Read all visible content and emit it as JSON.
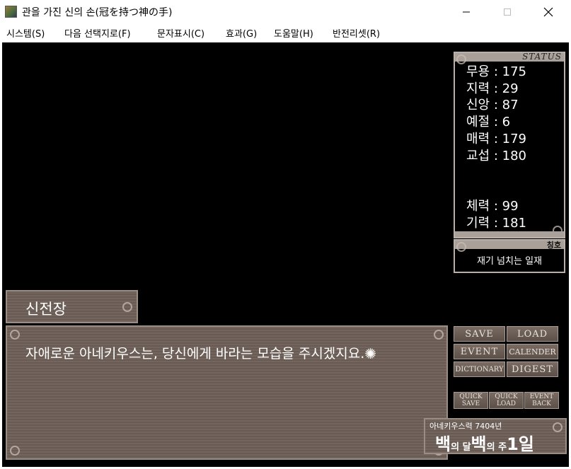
{
  "window": {
    "title": "관을 가진 신의 손(冠を持つ神の手)",
    "controls": {
      "minimize": "—",
      "maximize": "☐",
      "close": "✕"
    }
  },
  "menu": [
    {
      "label": "시스템(S)"
    },
    {
      "label": "다음 선택지로(F)"
    },
    {
      "label": "문자표시(C)"
    },
    {
      "label": "효과(G)"
    },
    {
      "label": "도움말(H)"
    },
    {
      "label": "반전리셋(R)"
    }
  ],
  "status": {
    "title": "STATUS",
    "stats": [
      {
        "label": "무용",
        "value": 175
      },
      {
        "label": "지력",
        "value": 29
      },
      {
        "label": "신앙",
        "value": 87
      },
      {
        "label": "예절",
        "value": 6
      },
      {
        "label": "매력",
        "value": 179
      },
      {
        "label": "교섭",
        "value": 180
      },
      {
        "label": "체력",
        "value": 99
      },
      {
        "label": "기력",
        "value": 181
      }
    ]
  },
  "title_panel": {
    "label": "칭호",
    "value": "재기 넘치는 일재"
  },
  "dialog": {
    "speaker": "신전장",
    "text": "자애로운 아네키우스는, 당신에게 바라는 모습을 주시겠지요."
  },
  "buttons": {
    "save": "SAVE",
    "load": "LOAD",
    "event": "EVENT",
    "calender": "CALENDER",
    "dictionary": "DICTIONARY",
    "digest": "DIGEST",
    "quick_save": [
      "QUICK",
      "SAVE"
    ],
    "quick_load": [
      "QUICK",
      "LOAD"
    ],
    "event_back": [
      "EVENT",
      "BACK"
    ]
  },
  "date": {
    "era": "아네키우스력 7404년",
    "month_num": "백",
    "month_suffix": "의 달",
    "week_num": "백",
    "week_suffix": "의 주",
    "day": "1일"
  },
  "colors": {
    "panel_stone": "#6e6057",
    "panel_border": "#9a8d84",
    "game_bg": "#000000"
  }
}
